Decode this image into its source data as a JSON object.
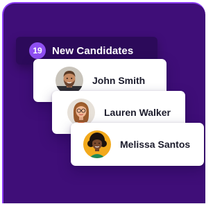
{
  "header": {
    "count": "19",
    "title": "New Candidates"
  },
  "candidates": [
    {
      "name": "John Smith",
      "avatar_icon": "person-photo-beard"
    },
    {
      "name": "Lauren Walker",
      "avatar_icon": "person-photo-glasses"
    },
    {
      "name": "Melissa Santos",
      "avatar_icon": "person-photo-curly-hair"
    }
  ],
  "colors": {
    "panel": "#3f0e78",
    "panel_border": "#8c3cf3",
    "header_bg": "#2c0a5a",
    "badge": "#8f4ff2",
    "card": "#ffffff",
    "name_text": "#1b1b2b"
  }
}
